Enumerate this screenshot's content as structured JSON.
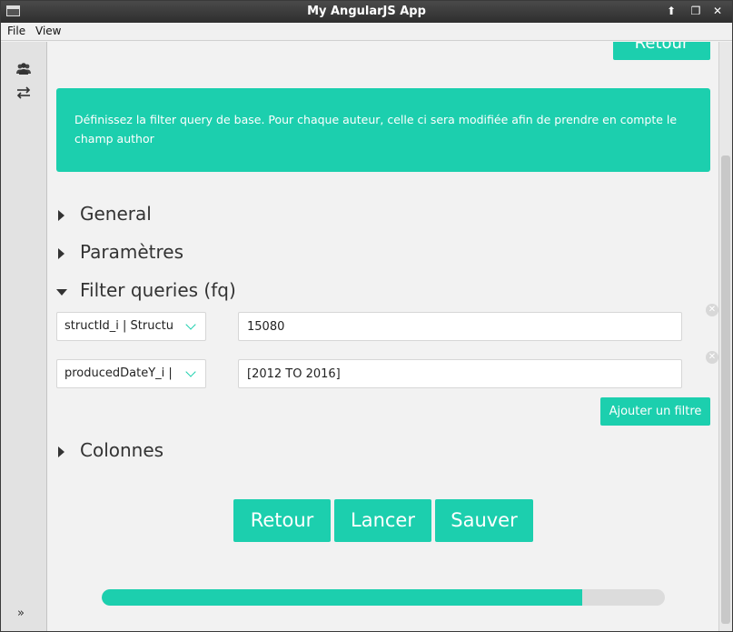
{
  "window": {
    "title": "My AngularJS App"
  },
  "titlebar_buttons": {
    "up": "⬆",
    "restore": "❐",
    "close": "✕"
  },
  "menu": {
    "file": "File",
    "view": "View"
  },
  "sidebar": {
    "icons": [
      "users-icon",
      "swap-arrows-icon"
    ],
    "expand": "»"
  },
  "top_button": {
    "label": "Retour"
  },
  "info": {
    "text": "Définissez la filter query de base. Pour chaque auteur, celle ci sera modifiée afin de prendre en compte le champ author"
  },
  "sections": {
    "general": "General",
    "parametres": "Paramètres",
    "filter_queries": "Filter queries (fq)",
    "colonnes": "Colonnes"
  },
  "filters": [
    {
      "field": "structId_i | Structu",
      "value": "15080"
    },
    {
      "field": "producedDateY_i |",
      "value": "[2012 TO 2016]"
    }
  ],
  "add_filter_label": "Ajouter un filtre",
  "actions": {
    "retour": "Retour",
    "lancer": "Lancer",
    "sauver": "Sauver"
  },
  "progress": {
    "fraction": 0.854
  },
  "colors": {
    "accent": "#1ccfae",
    "titlebar": "#2e2e2e"
  }
}
